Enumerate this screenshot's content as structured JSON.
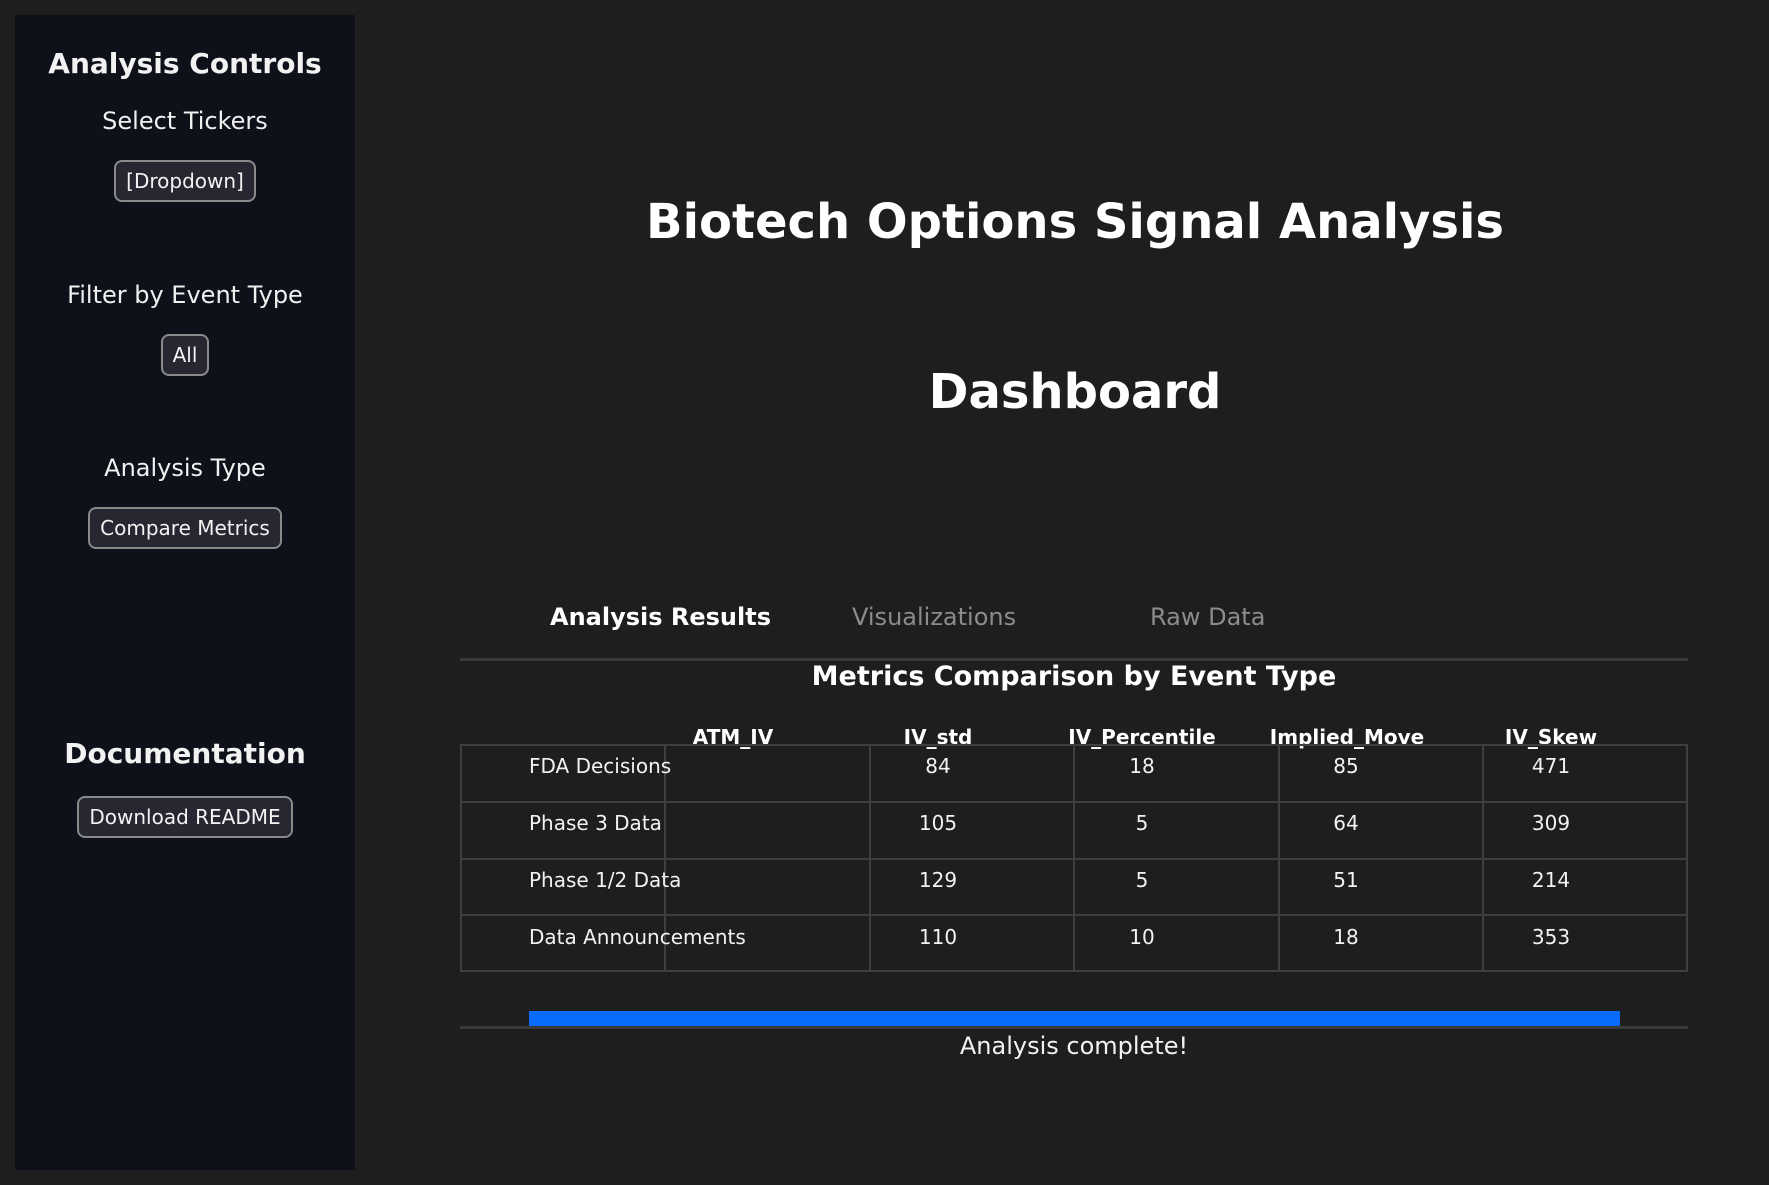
{
  "sidebar": {
    "title": "Analysis Controls",
    "tickers_label": "Select Tickers",
    "tickers_button": "[Dropdown]",
    "event_type_label": "Filter by Event Type",
    "event_type_button": "All",
    "analysis_type_label": "Analysis Type",
    "analysis_type_button": "Compare Metrics",
    "documentation_title": "Documentation",
    "readme_button": "Download README"
  },
  "main": {
    "title_line1": "Biotech Options Signal Analysis",
    "title_line2": "Dashboard",
    "tabs": [
      {
        "label": "Analysis Results",
        "active": true
      },
      {
        "label": "Visualizations",
        "active": false
      },
      {
        "label": "Raw Data",
        "active": false
      }
    ],
    "table": {
      "title": "Metrics Comparison by Event Type",
      "columns": [
        "ATM_IV",
        "IV_std",
        "IV_Percentile",
        "Implied_Move",
        "IV_Skew"
      ],
      "rows": [
        {
          "label": "FDA Decisions",
          "values": [
            "84",
            "18",
            "85",
            "471"
          ]
        },
        {
          "label": "Phase 3 Data",
          "values": [
            "105",
            "5",
            "64",
            "309"
          ]
        },
        {
          "label": "Phase 1/2 Data",
          "values": [
            "129",
            "5",
            "51",
            "214"
          ]
        },
        {
          "label": "Data Announcements",
          "values": [
            "110",
            "10",
            "18",
            "353"
          ]
        }
      ]
    },
    "progress": 1.0,
    "status": "Analysis complete!"
  },
  "colors": {
    "background": "#1e1e1e",
    "sidebar": "#0e111a",
    "progress": "#0a6cff"
  }
}
